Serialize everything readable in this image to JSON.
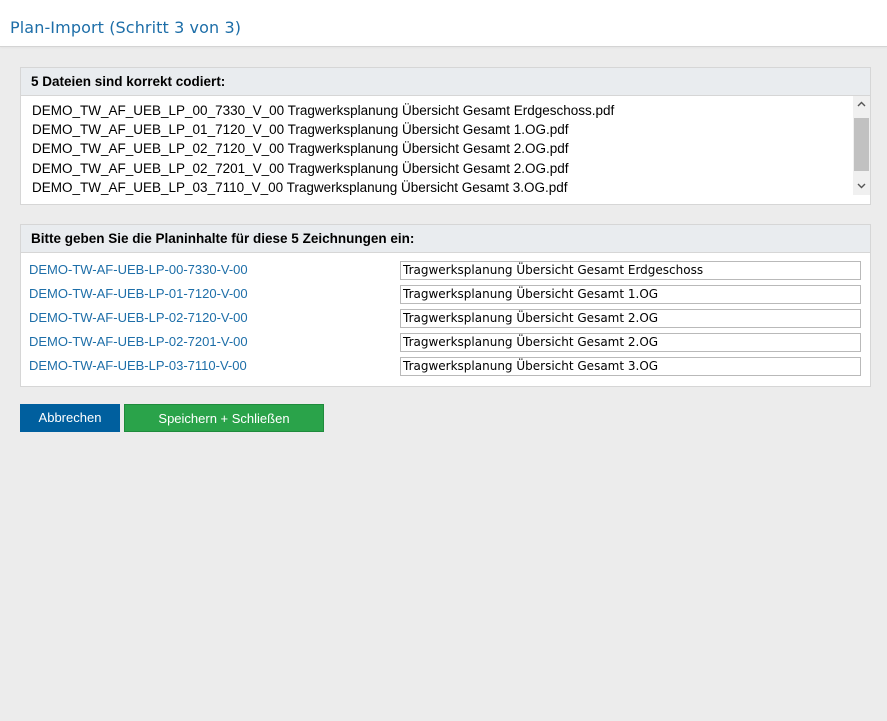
{
  "header": {
    "title": "Plan-Import (Schritt 3 von 3)"
  },
  "files_panel": {
    "heading": "5 Dateien sind korrekt codiert:",
    "files": [
      "DEMO_TW_AF_UEB_LP_00_7330_V_00 Tragwerksplanung Übersicht Gesamt Erdgeschoss.pdf",
      "DEMO_TW_AF_UEB_LP_01_7120_V_00 Tragwerksplanung Übersicht Gesamt 1.OG.pdf",
      "DEMO_TW_AF_UEB_LP_02_7120_V_00 Tragwerksplanung Übersicht Gesamt 2.OG.pdf",
      "DEMO_TW_AF_UEB_LP_02_7201_V_00 Tragwerksplanung Übersicht Gesamt 2.OG.pdf",
      "DEMO_TW_AF_UEB_LP_03_7110_V_00 Tragwerksplanung Übersicht Gesamt 3.OG.pdf"
    ],
    "scroll_icons": {
      "up": "chevron-up-icon",
      "down": "chevron-down-icon"
    }
  },
  "content_panel": {
    "heading": "Bitte geben Sie die Planinhalte für diese 5 Zeichnungen ein:",
    "rows": [
      {
        "code": "DEMO-TW-AF-UEB-LP-00-7330-V-00",
        "value": "Tragwerksplanung Übersicht Gesamt Erdgeschoss"
      },
      {
        "code": "DEMO-TW-AF-UEB-LP-01-7120-V-00",
        "value": "Tragwerksplanung Übersicht Gesamt 1.OG"
      },
      {
        "code": "DEMO-TW-AF-UEB-LP-02-7120-V-00",
        "value": "Tragwerksplanung Übersicht Gesamt 2.OG"
      },
      {
        "code": "DEMO-TW-AF-UEB-LP-02-7201-V-00",
        "value": "Tragwerksplanung Übersicht Gesamt 2.OG"
      },
      {
        "code": "DEMO-TW-AF-UEB-LP-03-7110-V-00",
        "value": "Tragwerksplanung Übersicht Gesamt 3.OG"
      }
    ]
  },
  "buttons": {
    "cancel_label": "Abbrechen",
    "save_label": "Speichern + Schließen"
  },
  "colors": {
    "title": "#1d6ea8",
    "link": "#1d6ea8",
    "cancel": "#005f9e",
    "save": "#2aa34a"
  }
}
